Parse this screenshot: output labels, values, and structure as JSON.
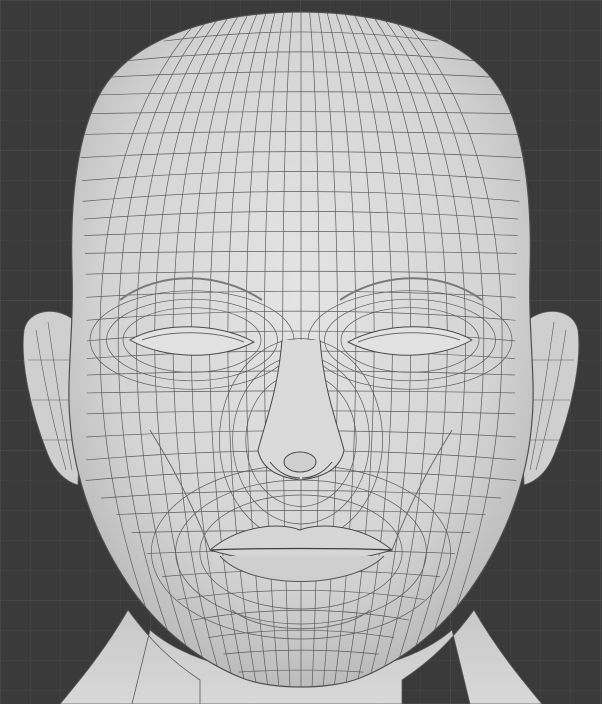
{
  "viewport": {
    "background_color": "#3a3a3a",
    "grid_minor_color": "#444444",
    "grid_major_color": "#4c4c4c",
    "mesh_fill_color": "#d9d9d9",
    "wire_color": "#555555",
    "object": "head-mesh"
  }
}
